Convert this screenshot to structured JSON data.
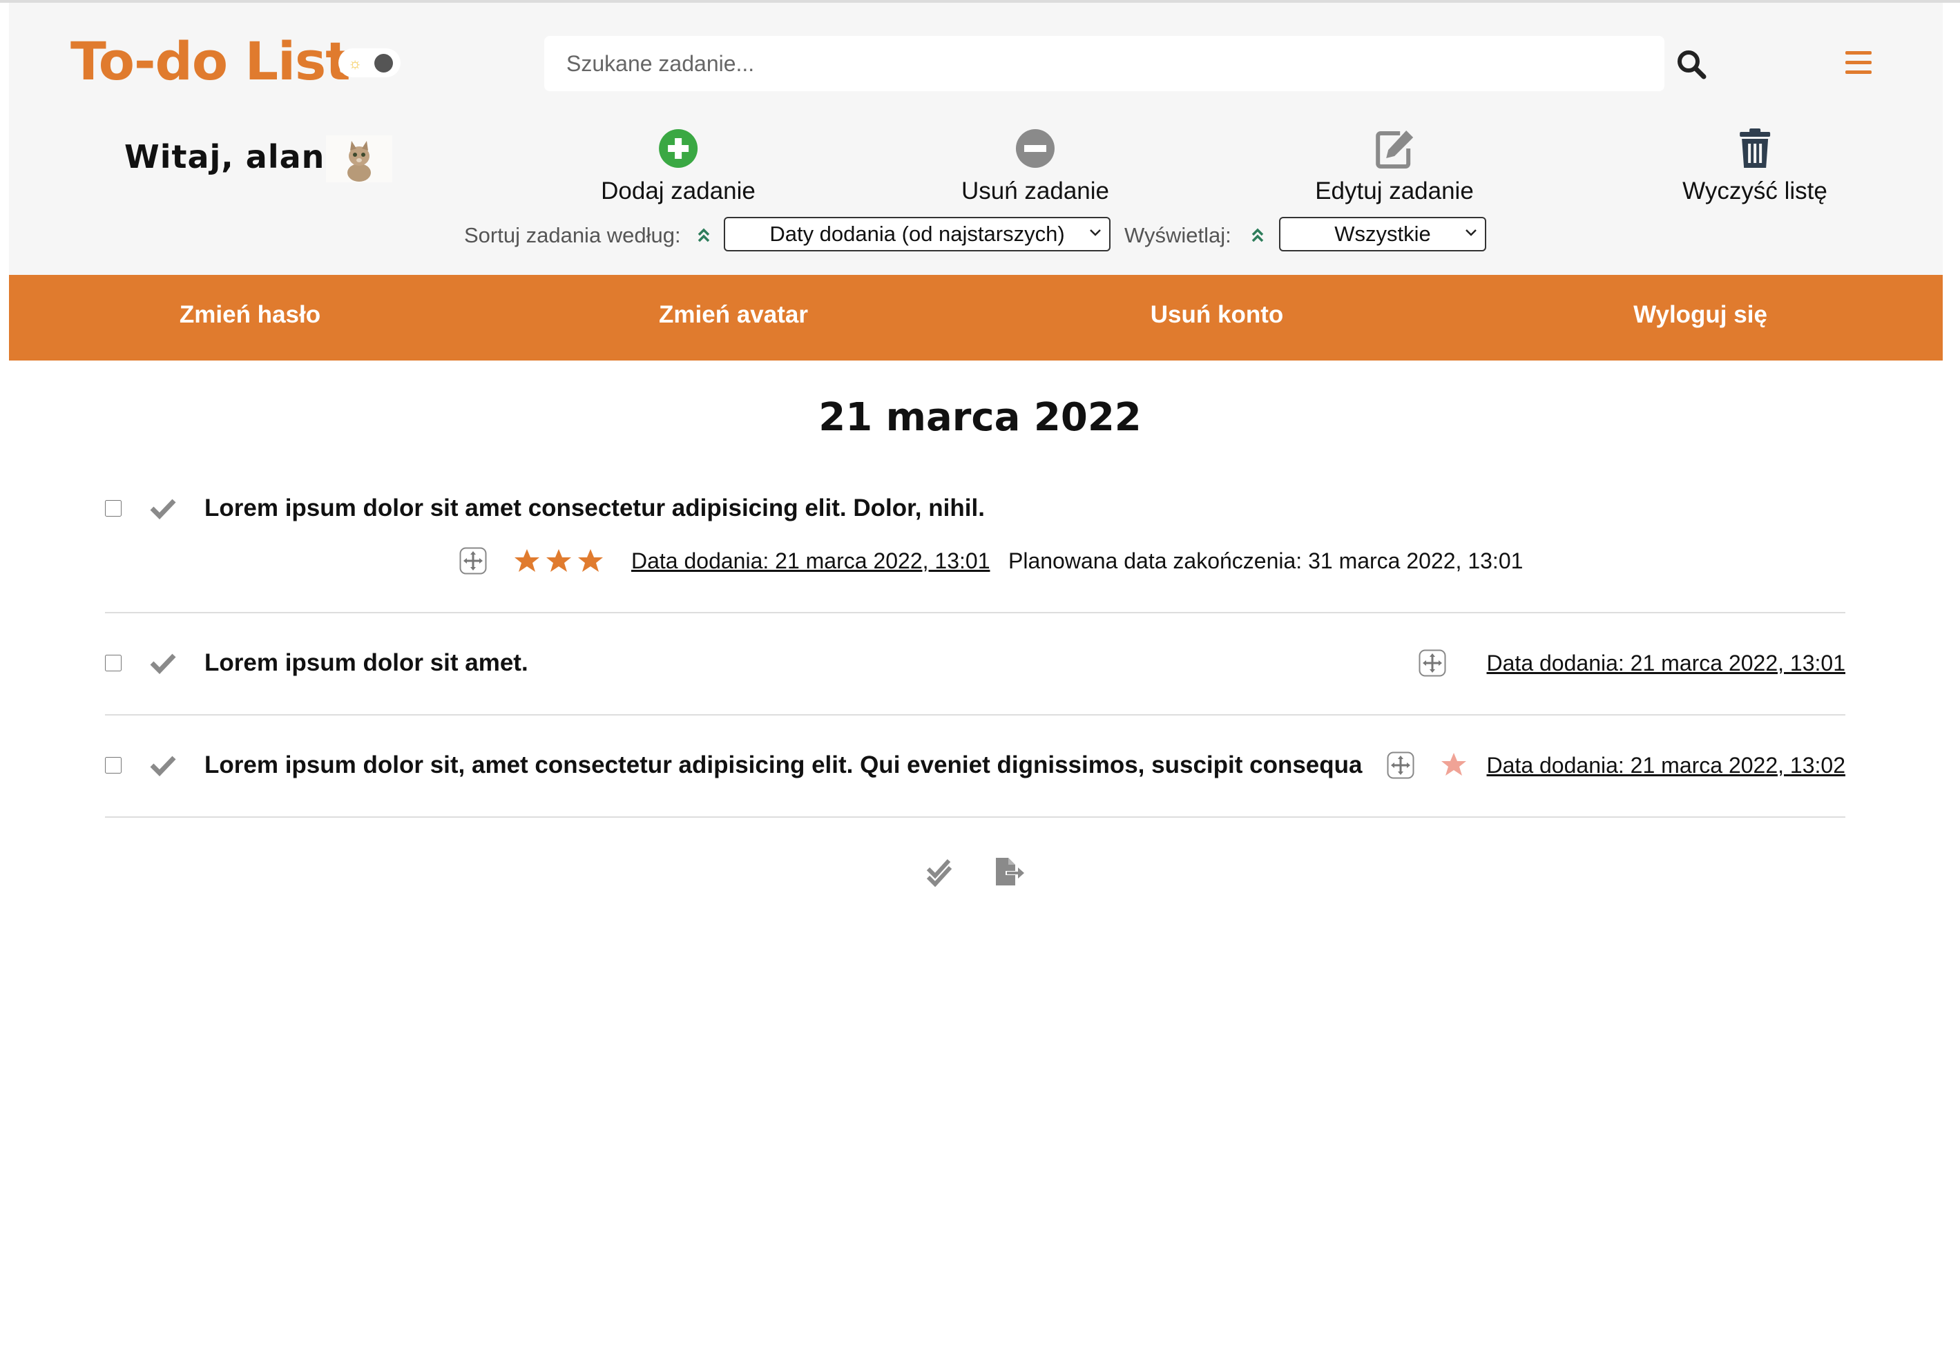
{
  "header": {
    "logo": "To-do List",
    "theme_toggle": {
      "sun_icon": "sun-icon",
      "mode": "light"
    },
    "search": {
      "placeholder": "Szukane zadanie...",
      "value": ""
    },
    "welcome": "Witaj, alan",
    "actions": [
      {
        "label": "Dodaj zadanie",
        "icon": "plus-circle-icon",
        "color": "#3aa843"
      },
      {
        "label": "Usuń zadanie",
        "icon": "minus-circle-icon",
        "color": "#8a8a8a"
      },
      {
        "label": "Edytuj zadanie",
        "icon": "edit-icon",
        "color": "#8a8a8a"
      },
      {
        "label": "Wyczyść listę",
        "icon": "trash-icon",
        "color": "#2f3e4e"
      }
    ],
    "sort": {
      "label": "Sortuj zadania według:",
      "selected": "Daty dodania (od najstarszych)"
    },
    "display": {
      "label": "Wyświetlaj:",
      "selected": "Wszystkie"
    }
  },
  "nav": [
    {
      "label": "Zmień hasło"
    },
    {
      "label": "Zmień avatar"
    },
    {
      "label": "Usuń konto"
    },
    {
      "label": "Wyloguj się"
    }
  ],
  "colors": {
    "accent": "#e07b2e",
    "star_full": "#e07b2e",
    "star_light": "#f0a396"
  },
  "list": {
    "date_heading": "21 marca 2022",
    "tasks": [
      {
        "title": "Lorem ipsum dolor sit amet consectetur adipisicing elit. Dolor, nihil.",
        "stars": 3,
        "date_added": "Data dodania: 21 marca 2022, 13:01",
        "planned": "Planowana data zakończenia: 31 marca 2022, 13:01"
      },
      {
        "title": "Lorem ipsum dolor sit amet.",
        "stars": 0,
        "date_added": "Data dodania: 21 marca 2022, 13:01"
      },
      {
        "title": "Lorem ipsum dolor sit, amet consectetur adipisicing elit. Qui eveniet dignissimos, suscipit consequa",
        "stars": 1,
        "date_added": "Data dodania: 21 marca 2022, 13:02"
      }
    ]
  },
  "footer_icons": [
    "double-check-icon",
    "file-export-icon"
  ]
}
